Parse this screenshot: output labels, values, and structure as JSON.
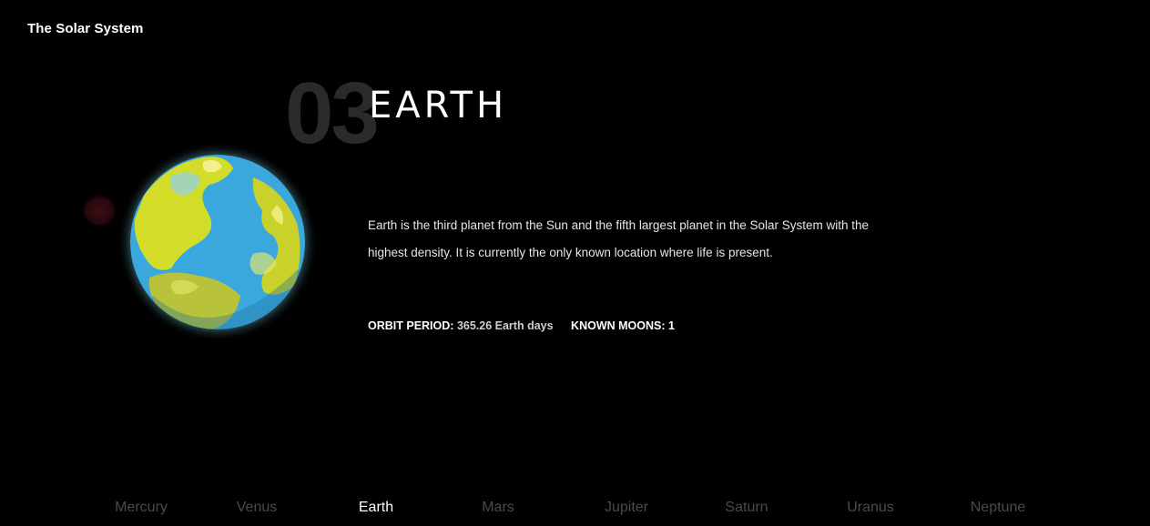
{
  "header": {
    "title": "The Solar System"
  },
  "planet": {
    "number": "03",
    "name": "EARTH",
    "description": "Earth is the third planet from the Sun and the fifth largest planet in the Solar System with the highest density. It is currently the only known location where life is present.",
    "stats": [
      {
        "label": "ORBIT PERIOD:",
        "value": "365.26 Earth days"
      },
      {
        "label": "KNOWN MOONS:",
        "value": "1"
      }
    ]
  },
  "nav": {
    "items": [
      {
        "label": "Mercury",
        "active": false
      },
      {
        "label": "Venus",
        "active": false
      },
      {
        "label": "Earth",
        "active": true
      },
      {
        "label": "Mars",
        "active": false
      },
      {
        "label": "Jupiter",
        "active": false
      },
      {
        "label": "Saturn",
        "active": false
      },
      {
        "label": "Uranus",
        "active": false
      },
      {
        "label": "Neptune",
        "active": false
      }
    ]
  },
  "colors": {
    "background": "#000000",
    "number_text": "#2a2a2a",
    "nav_inactive": "#4a4a4a",
    "nav_active": "#ffffff",
    "ocean": "#3aa8dc",
    "land": "#c8d22a",
    "glow": "#7fe6ff",
    "moon": "#3a0e14"
  }
}
